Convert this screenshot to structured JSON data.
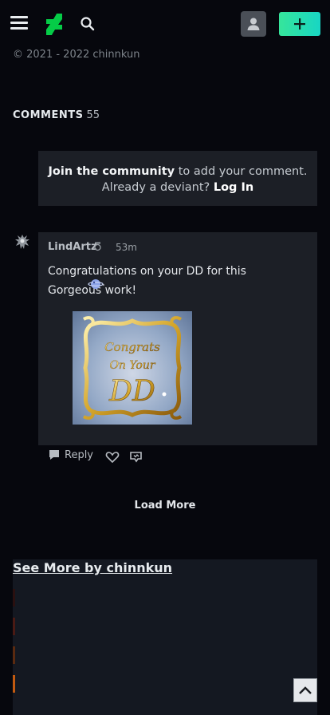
{
  "header": {
    "menu_icon": "hamburger-menu-icon",
    "logo_icon": "deviantart-logo-icon",
    "search_icon": "search-icon",
    "user_icon": "user-silhouette-icon",
    "submit_icon": "plus-icon",
    "colors": {
      "accent_start": "#36e59b",
      "accent_end": "#18d6c4",
      "background": "#06070d"
    }
  },
  "copyright": "© 2021 - 2022 chinnkun",
  "comments": {
    "heading": "COMMENTS",
    "count": "55",
    "join_box": {
      "strong": "Join the community",
      "middle": " to add your comment. Already a deviant? ",
      "login": "Log In"
    },
    "items": [
      {
        "author": "LindArtz",
        "author_badge_icon": "core-member-badge-icon",
        "time": "53m",
        "text": "Congratulations on your DD for this Gorgeous work!",
        "emote_icon": "planet-emote-icon",
        "image_alt": "Congrats On Your DD",
        "image_lines": [
          "Congrats",
          "On Your",
          "DD"
        ]
      }
    ],
    "actions": {
      "reply": "Reply",
      "reply_icon": "speech-bubble-icon",
      "like_icon": "heart-icon",
      "dislike_icon": "broken-heart-icon"
    },
    "load_more": "Load More"
  },
  "see_more": {
    "title": "See More by chinnkun"
  },
  "back_to_top_icon": "chevron-up-icon"
}
